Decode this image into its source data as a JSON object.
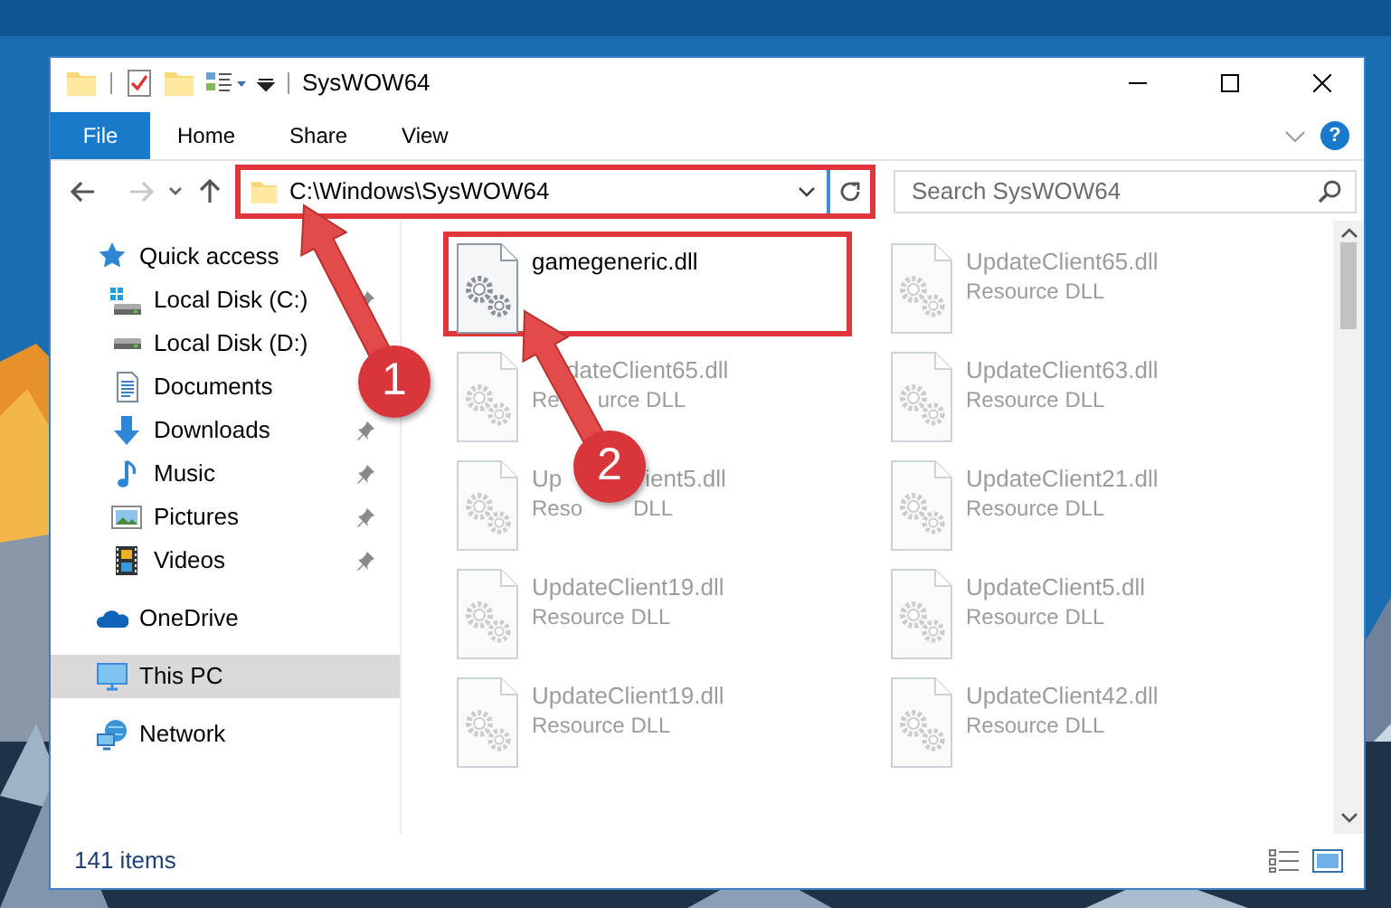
{
  "window": {
    "title": "SysWOW64"
  },
  "ribbon": {
    "tabs": [
      {
        "label": "File",
        "kind": "file"
      },
      {
        "label": "Home",
        "kind": "tab"
      },
      {
        "label": "Share",
        "kind": "tab"
      },
      {
        "label": "View",
        "kind": "tab"
      }
    ],
    "help": "?"
  },
  "navigation": {
    "back": {
      "disabled": false
    },
    "forward": {
      "disabled": true
    }
  },
  "address_bar": {
    "path": "C:\\Windows\\SysWOW64",
    "highlighted": true
  },
  "search": {
    "placeholder": "Search SysWOW64"
  },
  "sidebar": {
    "items": [
      {
        "label": "Quick access",
        "kind": "quick-access",
        "selected": false,
        "children": [
          {
            "label": "Local Disk (C:)",
            "kind": "system-drive",
            "pinned": true,
            "selected": false
          },
          {
            "label": "Local Disk (D:)",
            "kind": "drive",
            "selected": false
          },
          {
            "label": "Documents",
            "kind": "documents",
            "selected": false
          },
          {
            "label": "Downloads",
            "kind": "downloads",
            "pinned": true,
            "selected": false
          },
          {
            "label": "Music",
            "kind": "music",
            "pinned": true,
            "selected": false
          },
          {
            "label": "Pictures",
            "kind": "pictures",
            "pinned": true,
            "selected": false
          },
          {
            "label": "Videos",
            "kind": "videos",
            "pinned": true,
            "selected": false
          }
        ]
      },
      {
        "label": "OneDrive",
        "kind": "onedrive",
        "selected": false
      },
      {
        "label": "This PC",
        "kind": "pc",
        "selected": true
      },
      {
        "label": "Network",
        "kind": "network",
        "selected": false
      }
    ]
  },
  "files": [
    {
      "name": [
        "gamegeneric.dll"
      ],
      "highlighted": true,
      "dimmed": false
    },
    {
      "name": [
        "UpdateClient65.dll"
      ],
      "type": [
        "Resource DLL"
      ],
      "highlighted": false,
      "dimmed": true
    },
    {
      "name": [
        "dateClient65.dll"
      ],
      "type": [
        "Re",
        "urce DLL"
      ],
      "highlighted": false,
      "dimmed": true
    },
    {
      "name": [
        "UpdateClient63.dll"
      ],
      "type": [
        "Resource DLL"
      ],
      "highlighted": false,
      "dimmed": true
    },
    {
      "name": [
        "Up",
        "ient5.dll"
      ],
      "type": [
        "Reso",
        "DLL"
      ],
      "highlighted": false,
      "dimmed": true
    },
    {
      "name": [
        "UpdateClient21.dll"
      ],
      "type": [
        "Resource DLL"
      ],
      "highlighted": false,
      "dimmed": true
    },
    {
      "name": [
        "UpdateClient19.dll"
      ],
      "type": [
        "Resource DLL"
      ],
      "highlighted": false,
      "dimmed": true
    },
    {
      "name": [
        "UpdateClient5.dll"
      ],
      "type": [
        "Resource DLL"
      ],
      "highlighted": false,
      "dimmed": true
    },
    {
      "name": [
        "UpdateClient19.dll"
      ],
      "type": [
        "Resource DLL"
      ],
      "highlighted": false,
      "dimmed": true
    },
    {
      "name": [
        "UpdateClient42.dll"
      ],
      "type": [
        "Resource DLL"
      ],
      "highlighted": false,
      "dimmed": true
    }
  ],
  "status_bar": {
    "item_count": "141 items"
  },
  "callouts": [
    {
      "number": "1"
    },
    {
      "number": "2"
    }
  ]
}
